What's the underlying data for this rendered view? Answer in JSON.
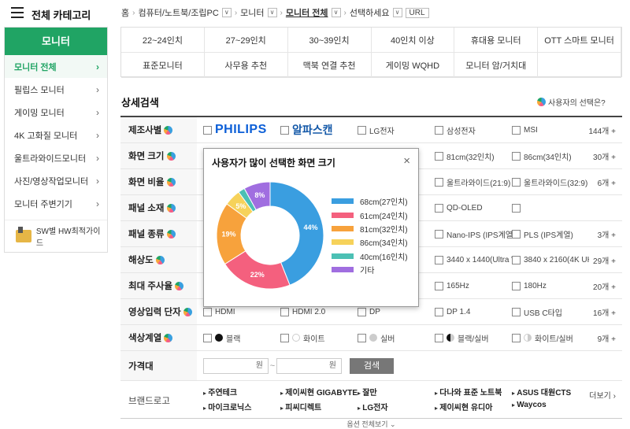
{
  "header": {
    "category_title": "전체 카테고리",
    "breadcrumb": [
      "홈",
      "컴퓨터/노트북/조립PC",
      "모니터",
      "모니터 전체",
      "선택하세요"
    ],
    "url_label": "URL"
  },
  "sidebar": {
    "title": "모니터",
    "items": [
      {
        "label": "모니터 전체",
        "active": true
      },
      {
        "label": "필립스 모니터"
      },
      {
        "label": "게이밍 모니터"
      },
      {
        "label": "4K 고화질 모니터"
      },
      {
        "label": "울트라와이드모니터"
      },
      {
        "label": "사진/영상작업모니터"
      },
      {
        "label": "모니터 주변기기"
      }
    ],
    "guide_label": "SW별 HW최적가이드"
  },
  "quick_categories": [
    "22~24인치",
    "27~29인치",
    "30~39인치",
    "40인치 이상",
    "휴대용 모니터",
    "OTT 스마트 모니터",
    "표준모니터",
    "사무용 추천",
    "맥북 연결 추천",
    "게이밍 WQHD",
    "모니터 암/거치대",
    ""
  ],
  "detail_search": {
    "title": "상세검색",
    "user_choice_label": "사용자의 선택은?",
    "rows": [
      {
        "label": "제조사별",
        "options": [
          "PHILIPS",
          "알파스캔",
          "LG전자",
          "삼성전자",
          "MSI"
        ],
        "count": "144개 +"
      },
      {
        "label": "화면 크기",
        "options": [
          "",
          "",
          "",
          "81cm(32인치)",
          "86cm(34인치)"
        ],
        "count": "30개 +"
      },
      {
        "label": "화면 비율",
        "options": [
          "",
          "",
          "",
          "울트라와이드(21:9)",
          "울트라와이드(32:9)"
        ],
        "count": "6개 +"
      },
      {
        "label": "패널 소재",
        "options": [
          "",
          "",
          "",
          "QD-OLED",
          ""
        ],
        "count": ""
      },
      {
        "label": "패널 종류",
        "options": [
          "",
          "",
          "",
          "Nano-IPS (IPS계열)",
          "PLS (IPS계열)"
        ],
        "count": "3개 +"
      },
      {
        "label": "해상도",
        "options": [
          "",
          "",
          ")",
          "3440 x 1440(Ultra WQ",
          "3840 x 2160(4K UHD)"
        ],
        "count": "29개 +"
      },
      {
        "label": "최대 주사율",
        "options": [
          "",
          "",
          "",
          "165Hz",
          "180Hz"
        ],
        "count": "20개 +"
      },
      {
        "label": "영상입력 단자",
        "options": [
          "HDMI",
          "HDMI 2.0",
          "DP",
          "DP 1.4",
          "USB C타입"
        ],
        "count": "16개 +"
      },
      {
        "label": "색상계열",
        "options": [
          "블랙",
          "화이트",
          "실버",
          "블랙/실버",
          "화이트/실버"
        ],
        "count": "9개 +"
      }
    ],
    "price": {
      "label": "가격대",
      "unit": "원",
      "tilde": "~",
      "search_button": "검색"
    },
    "brand_logo": {
      "label": "브랜드로고",
      "row1": [
        "주연테크",
        "제이씨현 GIGABYTE",
        "잘만",
        "다나와 표준 노트북",
        "ASUS 대원CTS"
      ],
      "row2": [
        "마이크로닉스",
        "피씨디렉트",
        "LG전자",
        "제이씨현 유디아",
        "Waycos"
      ],
      "more": "더보기 ›"
    },
    "bottom_text": "옵션 전체보기 ⌄"
  },
  "popup": {
    "title": "사용자가 많이 선택한 화면 크기",
    "close": "×",
    "chart_data": {
      "type": "pie",
      "categories": [
        "68cm(27인치)",
        "61cm(24인치)",
        "81cm(32인치)",
        "86cm(34인치)",
        "40cm(16인치)",
        "기타"
      ],
      "values": [
        44,
        22,
        19,
        5,
        2,
        8
      ],
      "labels": [
        "44%",
        "22%",
        "19%",
        "5%",
        "",
        "8%"
      ],
      "colors": [
        "#3a9ee0",
        "#f4607e",
        "#f7a23c",
        "#f6d25a",
        "#4cc0b4",
        "#a06ee0"
      ],
      "legend_position": "right"
    }
  }
}
